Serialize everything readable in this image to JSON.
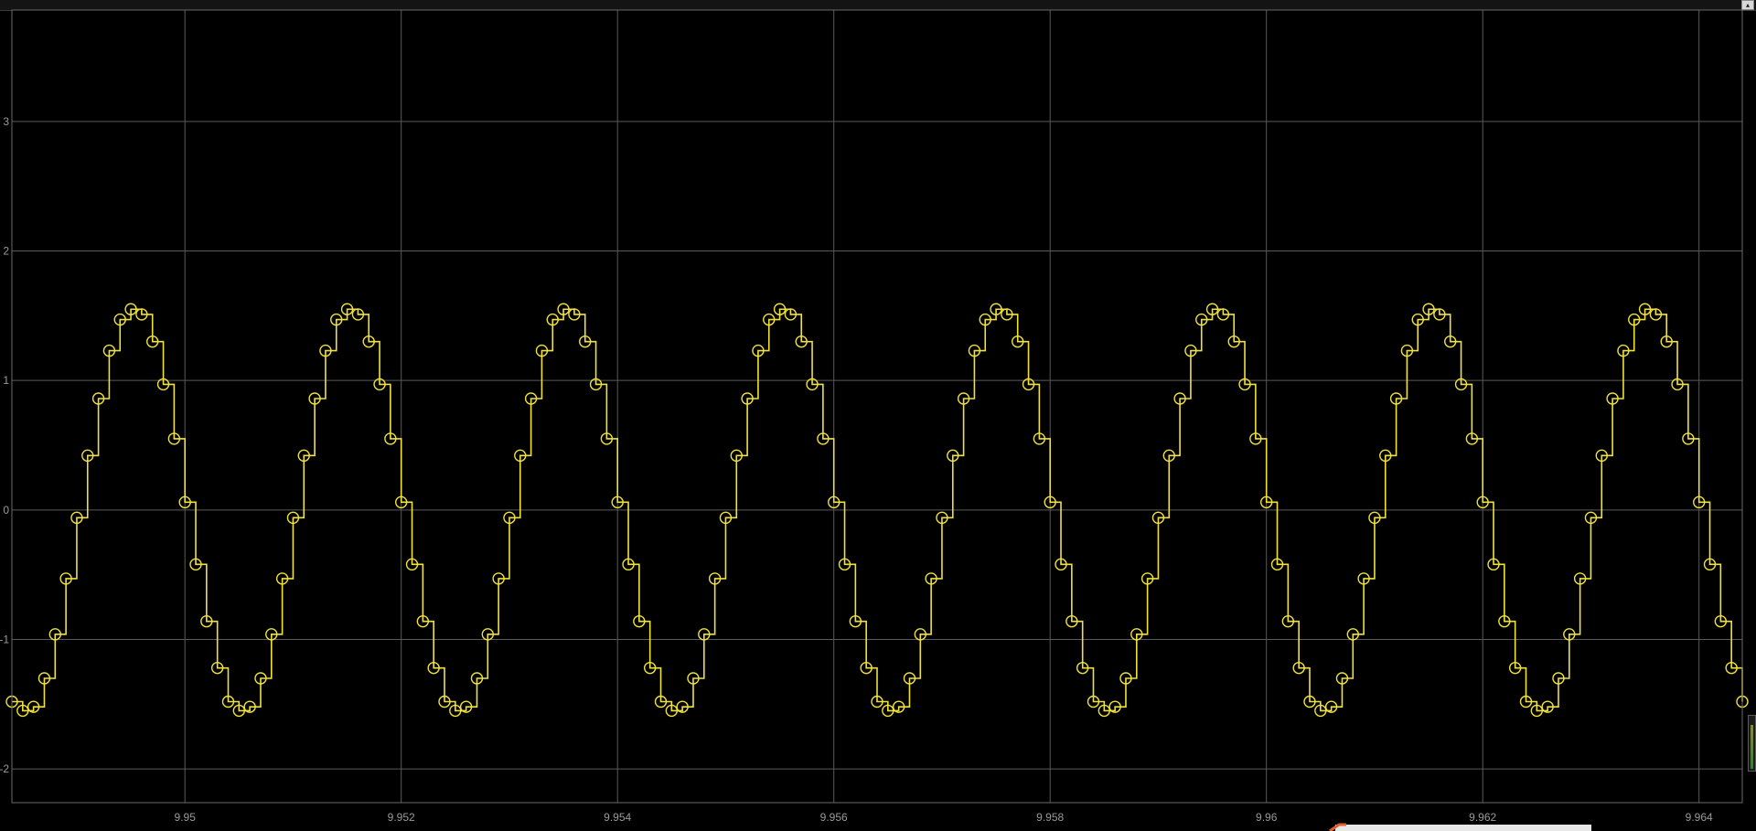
{
  "window": {
    "collapse_icon": "up-arrow-icon"
  },
  "colors": {
    "background": "#000000",
    "grid": "#5a5a5a",
    "trace": "#f0e23a",
    "tick_text": "#9a9a9a"
  },
  "chart_data": {
    "type": "line",
    "style": "stairs-with-circle-markers",
    "title": "",
    "xlabel": "",
    "ylabel": "",
    "grid": true,
    "xlim": [
      9.9484,
      9.9644
    ],
    "ylim": [
      -2.26,
      3.86
    ],
    "x_ticks": [
      "9.95",
      "9.952",
      "9.954",
      "9.956",
      "9.958",
      "9.96",
      "9.962",
      "9.964"
    ],
    "x_tick_values": [
      9.95,
      9.952,
      9.954,
      9.956,
      9.958,
      9.96,
      9.962,
      9.964
    ],
    "y_ticks": [
      "-2",
      "-1",
      "0",
      "1",
      "2",
      "3"
    ],
    "y_tick_values": [
      -2,
      -1,
      0,
      1,
      2,
      3
    ],
    "sample_period": 0.0001,
    "period_samples": 20,
    "x_start": 9.9484,
    "cycle_values": [
      -1.48,
      -1.55,
      -1.52,
      -1.3,
      -0.96,
      -0.53,
      -0.06,
      0.42,
      0.86,
      1.23,
      1.47,
      1.55,
      1.51,
      1.3,
      0.97,
      0.55,
      0.06,
      -0.42,
      -0.86,
      -1.22
    ],
    "cycles": 9
  }
}
